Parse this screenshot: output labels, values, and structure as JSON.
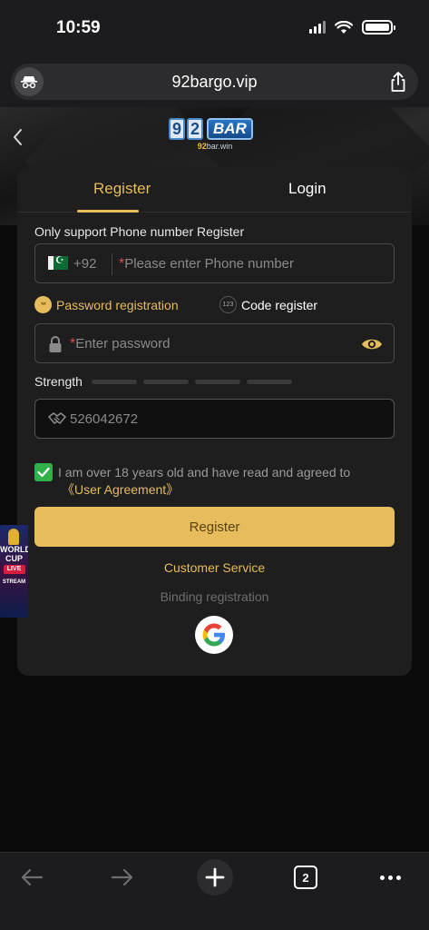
{
  "status_bar": {
    "time": "10:59"
  },
  "browser": {
    "url": "92bargo.vip",
    "open_tabs": "2"
  },
  "logo": {
    "digits": [
      "9",
      "2"
    ],
    "bar": "BAR",
    "sub_prefix": "92",
    "sub_main": "bar",
    "sub_suffix": ".win"
  },
  "tabs": {
    "register": "Register",
    "login": "Login"
  },
  "form": {
    "support_text": "Only support Phone number Register",
    "country_code": "+92",
    "required_mark": "*",
    "phone_placeholder": "Please enter Phone number",
    "mode_password_icon": "**",
    "mode_password": "Password registration",
    "mode_code_icon": "123",
    "mode_code": "Code register",
    "password_placeholder": "Enter password",
    "strength_label": "Strength",
    "invite_code": "526042672",
    "agree_text": "I am over 18 years old and have read and agreed to",
    "agree_link": "《User Agreement》",
    "register_button": "Register",
    "customer_service": "Customer Service",
    "binding_text": "Binding registration"
  },
  "promo": {
    "line1": "WORLD",
    "line2": "CUP",
    "live": "LIVE",
    "stream": "STREAM"
  },
  "colors": {
    "accent": "#e6bc5c",
    "check": "#32b04a",
    "background": "#0a0a0a",
    "card": "#1e1e1e"
  }
}
